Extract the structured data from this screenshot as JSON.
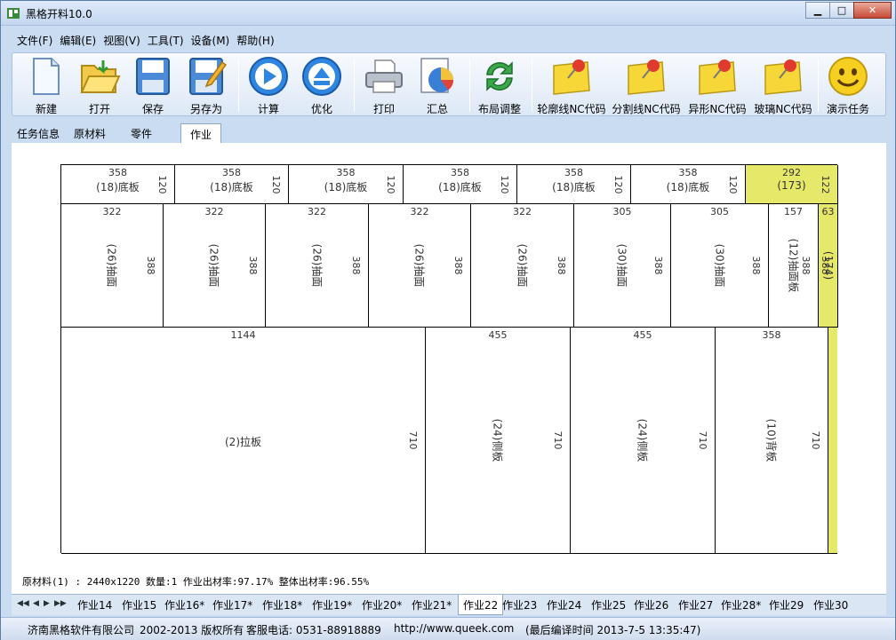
{
  "window": {
    "title": "黑格开料10.0",
    "buttons": {
      "minimize": "▁",
      "maximize": "□",
      "close": "✕"
    }
  },
  "menu": [
    "文件(F)",
    "编辑(E)",
    "视图(V)",
    "工具(T)",
    "设备(M)",
    "帮助(H)"
  ],
  "toolbar": [
    {
      "label": "新建",
      "icon": "new-doc-icon"
    },
    {
      "label": "打开",
      "icon": "folder-open-icon"
    },
    {
      "label": "保存",
      "icon": "floppy-save-icon"
    },
    {
      "label": "另存为",
      "icon": "save-as-icon"
    },
    {
      "label": "计算",
      "icon": "play-icon"
    },
    {
      "label": "优化",
      "icon": "eject-icon"
    },
    {
      "label": "打印",
      "icon": "printer-icon"
    },
    {
      "label": "汇总",
      "icon": "pie-chart-icon"
    },
    {
      "label": "布局调整",
      "icon": "refresh-icon"
    },
    {
      "label": "轮廓线NC代码",
      "icon": "pin-note-icon"
    },
    {
      "label": "分割线NC代码",
      "icon": "pin-note-icon"
    },
    {
      "label": "异形NC代码",
      "icon": "pin-note-icon"
    },
    {
      "label": "玻璃NC代码",
      "icon": "pin-note-icon"
    },
    {
      "label": "演示任务",
      "icon": "smiley-icon"
    }
  ],
  "top_tabs": [
    "任务信息",
    "原材料",
    "零件",
    "作业"
  ],
  "layout": {
    "row1": [
      {
        "w": "358",
        "h": "120",
        "label": "(18)底板"
      },
      {
        "w": "358",
        "h": "120",
        "label": "(18)底板"
      },
      {
        "w": "358",
        "h": "120",
        "label": "(18)底板"
      },
      {
        "w": "358",
        "h": "120",
        "label": "(18)底板"
      },
      {
        "w": "358",
        "h": "120",
        "label": "(18)底板"
      },
      {
        "w": "358",
        "h": "120",
        "label": "(18)底板"
      },
      {
        "w": "292",
        "h": "122",
        "label": "(173)"
      }
    ],
    "row2": [
      {
        "w": "322",
        "h": "388",
        "label": "(26)抽面"
      },
      {
        "w": "322",
        "h": "388",
        "label": "(26)抽面"
      },
      {
        "w": "322",
        "h": "388",
        "label": "(26)抽面"
      },
      {
        "w": "322",
        "h": "388",
        "label": "(26)抽面"
      },
      {
        "w": "322",
        "h": "388",
        "label": "(26)抽面"
      },
      {
        "w": "305",
        "h": "388",
        "label": "(30)抽面"
      },
      {
        "w": "305",
        "h": "388",
        "label": "(30)抽面"
      },
      {
        "w": "157",
        "h": "388",
        "label": "(12)抽面板"
      },
      {
        "w": "63",
        "h": "388",
        "label": "(174)"
      }
    ],
    "row3": [
      {
        "w": "1144",
        "h": "710",
        "label": "(2)拉板"
      },
      {
        "w": "455",
        "h": "710",
        "label": "(24)侧板"
      },
      {
        "w": "455",
        "h": "710",
        "label": "(24)侧板"
      },
      {
        "w": "358",
        "h": "710",
        "label": "(10)背板"
      }
    ]
  },
  "stats": "原材料(1) : 2440x1220  数量:1  作业出材率:97.17%  整体出材率:96.55%",
  "bottom_tabs": [
    "作业14",
    "作业15",
    "作业16*",
    "作业17*",
    "作业18*",
    "作业19*",
    "作业20*",
    "作业21*",
    "作业22",
    "作业23",
    "作业24",
    "作业25",
    "作业26",
    "作业27",
    "作业28*",
    "作业29",
    "作业30"
  ],
  "status": {
    "company": "济南黑格软件有限公司",
    "copyright": "2002-2013 版权所有",
    "phone": "客服电话: 0531-88918889",
    "url": "http://www.queek.com",
    "build": "(最后编译时间 2013-7-5 13:35:47)"
  },
  "colors": {
    "waste": "#e6e86a",
    "frame": "#c9dcf2",
    "accent_blue": "#2f86e0"
  }
}
